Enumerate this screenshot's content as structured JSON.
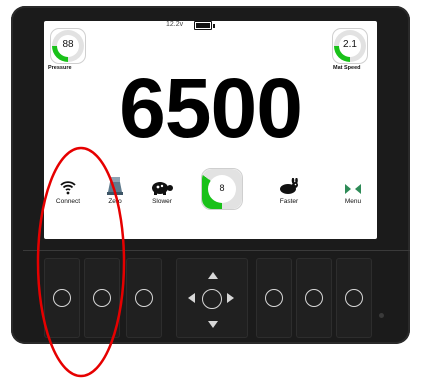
{
  "status": {
    "voltage": "12.2v"
  },
  "gauges": {
    "pressure": {
      "value": "88",
      "label": "Pressure",
      "level": 0.25
    },
    "mat_speed": {
      "value": "2.1",
      "label": "Mat Speed",
      "level": 0.25
    }
  },
  "main_value": "6500",
  "buttons": {
    "connect": "Connect",
    "zero": "Zero",
    "slower": "Slower",
    "setting_value": "8",
    "setting_level": 0.35,
    "faster": "Faster",
    "menu": "Menu"
  },
  "colors": {
    "accent": "#19c119",
    "bezel": "#1b1b1b",
    "annotation": "#e60000"
  },
  "icons": {
    "connect": "wifi-icon",
    "zero": "scale-icon",
    "slower": "turtle-icon",
    "faster": "rabbit-icon",
    "menu": "menu-arrows-icon"
  }
}
